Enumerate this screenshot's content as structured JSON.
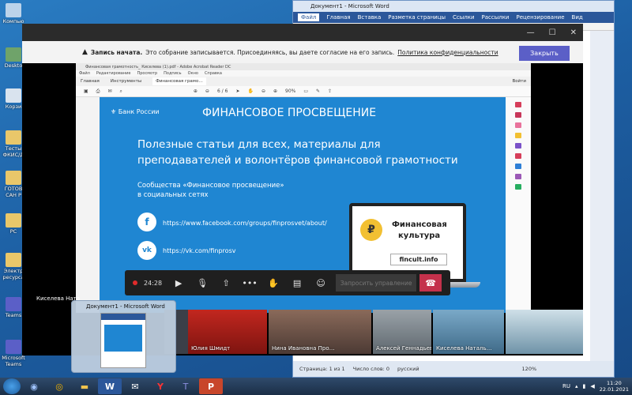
{
  "desktop": {
    "icons": [
      "Компью",
      "Deskto",
      "Корзи",
      "Тесты ФКИС/Д",
      "ГОТОВ CAH P",
      "PC",
      "Электр ресурса",
      "Teams",
      "Microsoft Teams"
    ]
  },
  "word": {
    "title": "Документ1 - Microsoft Word",
    "tabs": [
      "Файл",
      "Главная",
      "Вставка",
      "Разметка страницы",
      "Ссылки",
      "Рассылки",
      "Рецензирование",
      "Вид"
    ],
    "status": {
      "page": "Страница: 1 из 1",
      "words": "Число слов: 0",
      "lang": "русский",
      "zoom": "120%"
    }
  },
  "teams": {
    "window_controls": [
      "—",
      "☐",
      "✕"
    ],
    "banner": {
      "bold": "Запись начата.",
      "text": "Это собрание записывается. Присоединяясь, вы даете согласие на его запись.",
      "link": "Политика конфиденциальности",
      "close": "Закрыть"
    },
    "presenter_name": "Киселева Ната",
    "call": {
      "timer": "24:28",
      "request_control": "Запросить управление"
    },
    "participants": [
      "Юлия Шмидт",
      "Нина Ивановна Про…",
      "Алексей Геннадьев…",
      "Киселева Наталь…"
    ]
  },
  "acrobat": {
    "title": "Финансовая грамотность_ Киселева (1).pdf - Adobe Acrobat Reader DC",
    "menu": [
      "Файл",
      "Редактирование",
      "Просмотр",
      "Подпись",
      "Окно",
      "Справка"
    ],
    "tabs": [
      "Главная",
      "Инструменты",
      "Финансовая грамо…"
    ],
    "login": "Войти",
    "page_indicator": "6 / 6",
    "zoom": "90%"
  },
  "slide": {
    "brand": "Банк России",
    "header": "ФИНАНСОВОЕ ПРОСВЕЩЕНИЕ",
    "subtitle_line1": "Полезные статьи для всех, материалы для",
    "subtitle_line2": "преподавателей и волонтёров финансовой грамотности",
    "community_line1": "Сообщества «Финансовое просвещение»",
    "community_line2": "в социальных сетях",
    "links": [
      "https://www.facebook.com/groups/finprosvet/about/",
      "https://vk.com/finprosv"
    ],
    "laptop_title_line1": "Финансовая",
    "laptop_title_line2": "культура",
    "laptop_url": "fincult.info",
    "ruble": "₽"
  },
  "taskbar": {
    "preview_title": "Документ1 - Microsoft Word",
    "lang": "RU",
    "time": "11:20",
    "date": "22.01.2021"
  },
  "colors": {
    "slide_blue": "#1f86d2",
    "teams_purple": "#5b5fc7",
    "hangup_red": "#c4314b"
  }
}
